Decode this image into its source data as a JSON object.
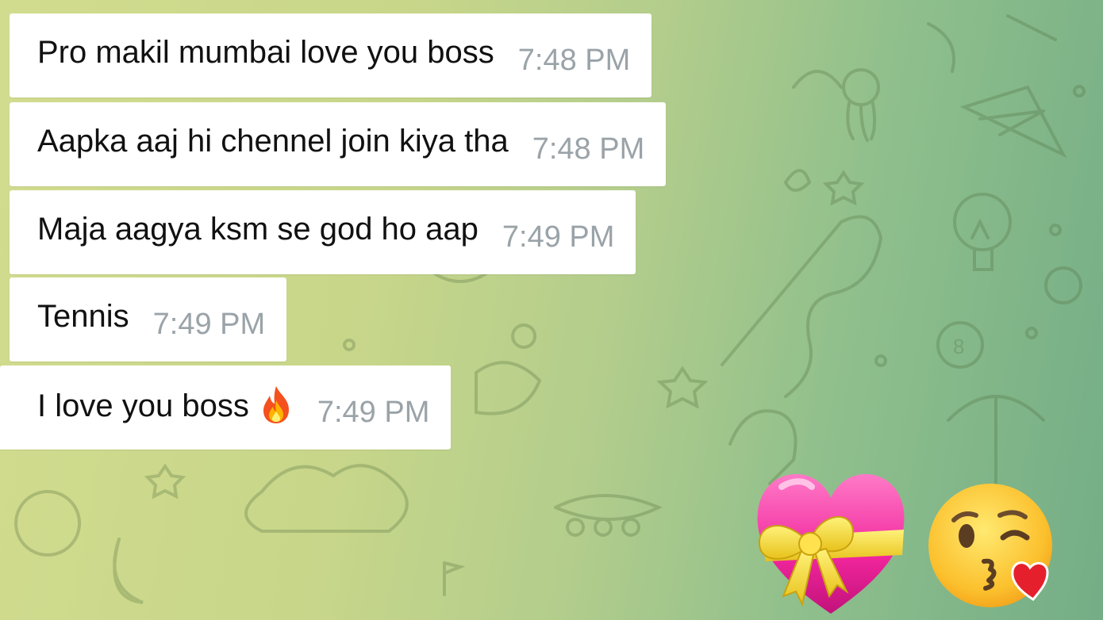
{
  "messages": [
    {
      "text": "Pro makil mumbai love you boss",
      "time": "7:48 PM"
    },
    {
      "text": "Aapka aaj hi chennel join kiya tha",
      "time": "7:48 PM"
    },
    {
      "text": "Maja aagya ksm se god ho aap",
      "time": "7:49 PM"
    },
    {
      "text": "Tennis",
      "time": "7:49 PM"
    },
    {
      "text": "I love you boss",
      "time": "7:49 PM",
      "emoji": "fire-icon"
    }
  ],
  "stickers": [
    {
      "icon": "heart-with-ribbon-icon"
    },
    {
      "icon": "face-blowing-kiss-icon"
    }
  ],
  "colors": {
    "bubble": "#ffffff",
    "text": "#111111",
    "time": "#9aa3a8",
    "background_left": "#d2dc8e",
    "background_right": "#74ad86"
  }
}
